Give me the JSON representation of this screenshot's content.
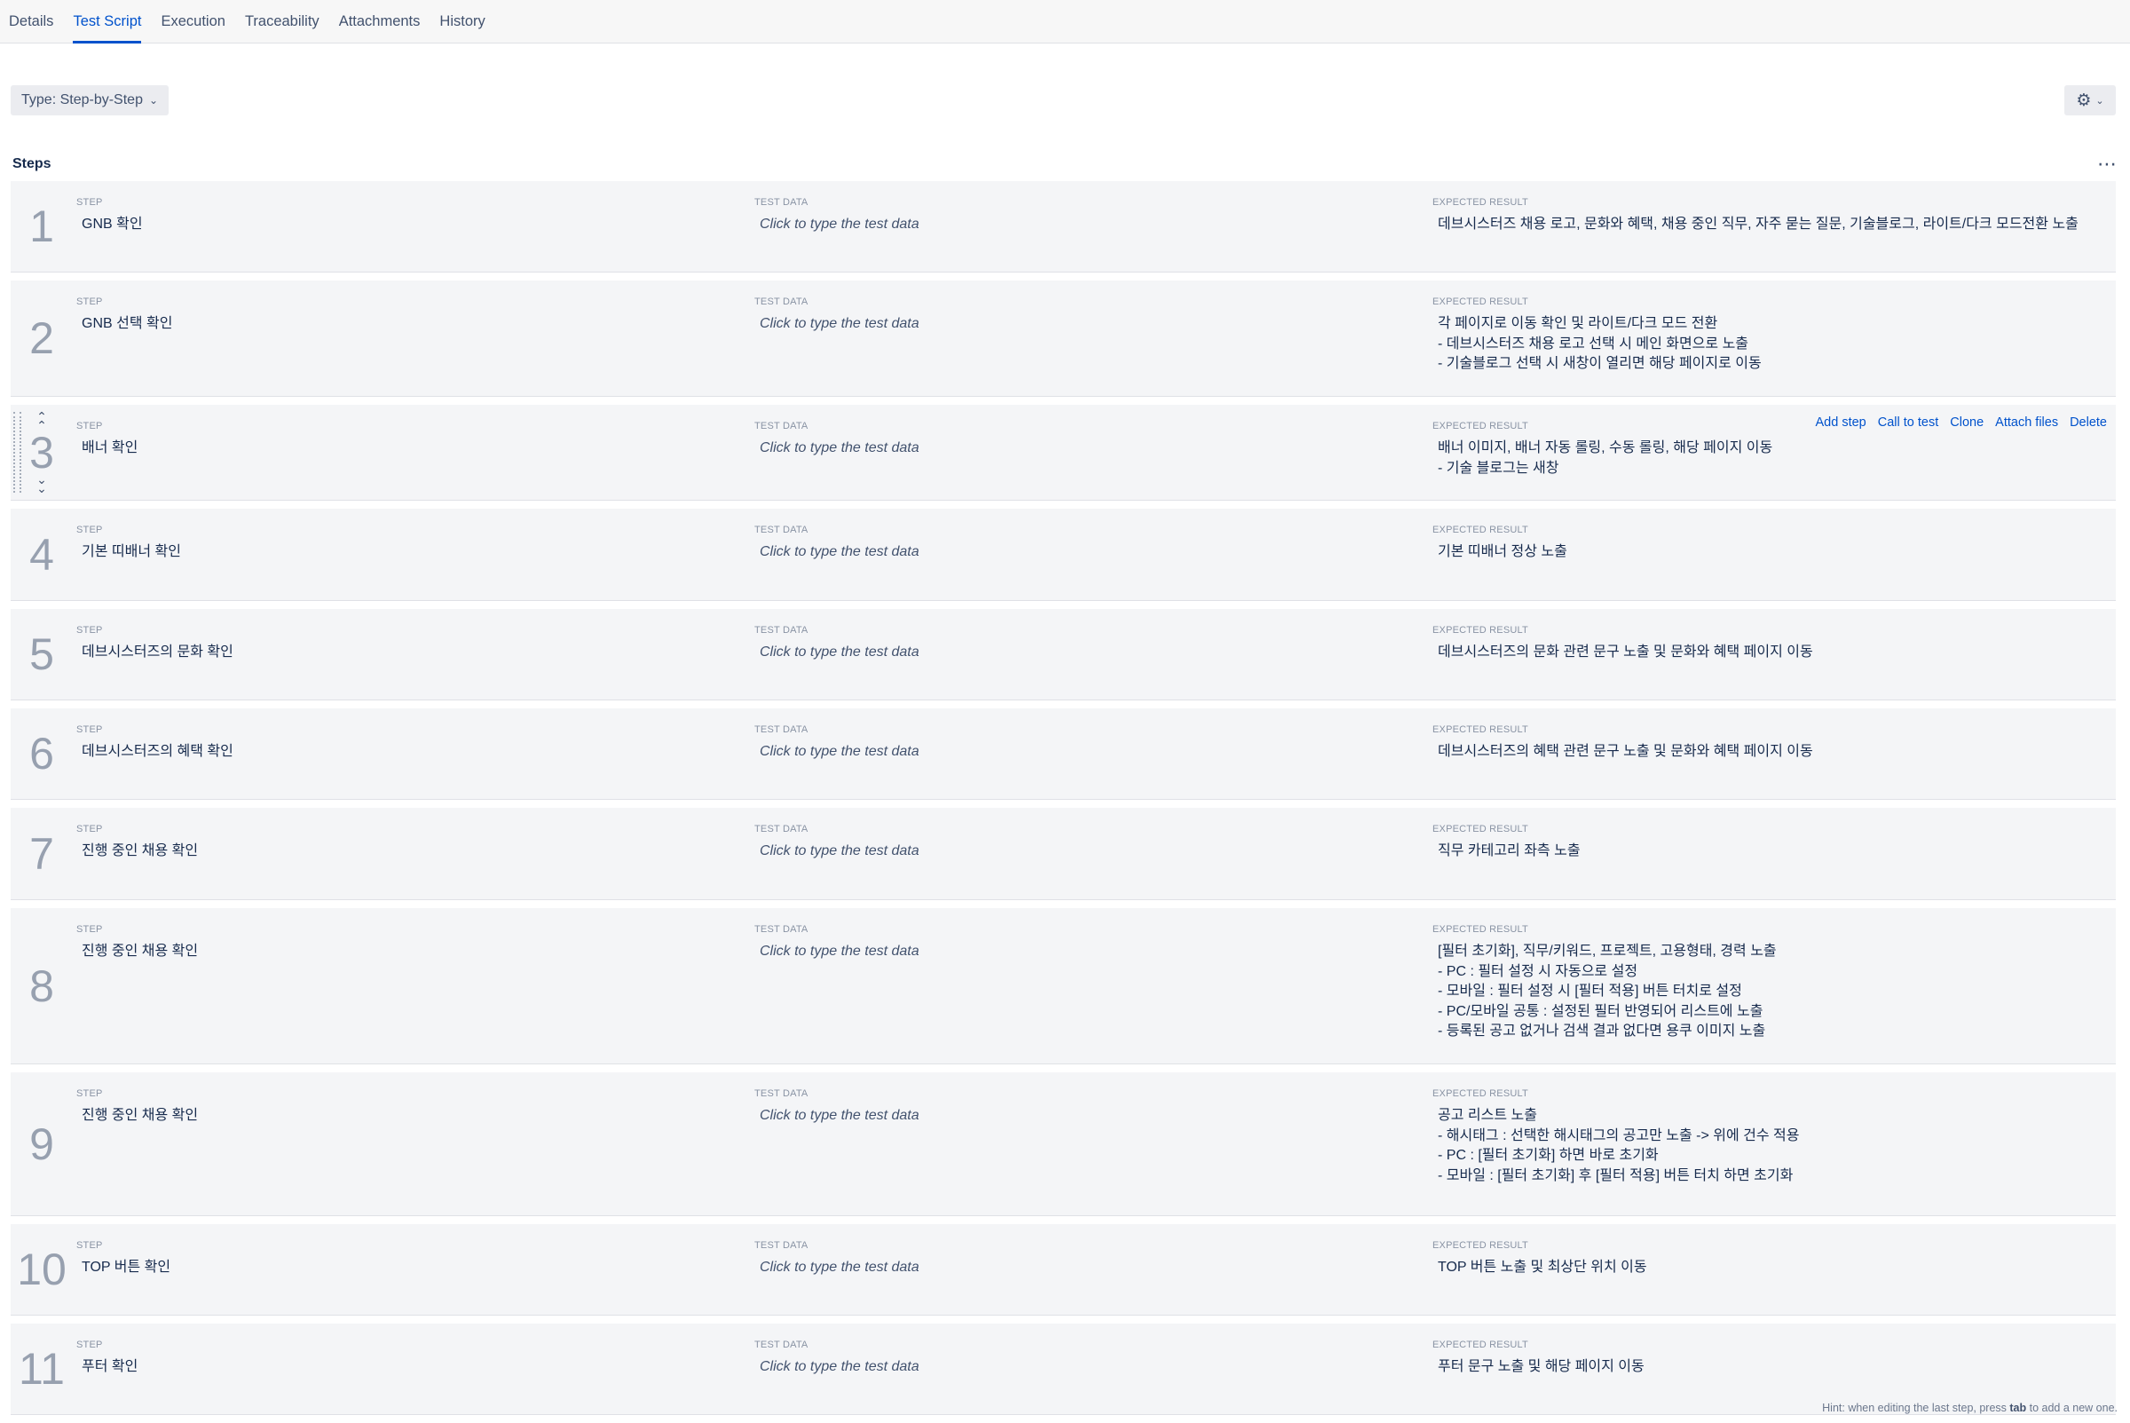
{
  "tabs": [
    {
      "label": "Details"
    },
    {
      "label": "Test Script"
    },
    {
      "label": "Execution"
    },
    {
      "label": "Traceability"
    },
    {
      "label": "Attachments"
    },
    {
      "label": "History"
    }
  ],
  "active_tab": "Test Script",
  "toolbar": {
    "type_label": "Type: Step-by-Step",
    "gear_icon": "gear-icon",
    "chevron_icon": "chevron-down-icon"
  },
  "steps_section": {
    "title": "Steps",
    "more_icon": "more-icon"
  },
  "column_labels": {
    "step": "STEP",
    "test_data": "TEST DATA",
    "expected": "EXPECTED RESULT"
  },
  "row_actions": {
    "add_step": "Add step",
    "call_to_test": "Call to test",
    "clone": "Clone",
    "attach_files": "Attach files",
    "delete": "Delete"
  },
  "steps": [
    {
      "num": "1",
      "step": "GNB 확인",
      "test_data": "Click to type the test data",
      "expected": "데브시스터즈 채용 로고, 문화와 혜택, 채용 중인 직무, 자주 묻는 질문, 기술블로그, 라이트/다크 모드전환 노출"
    },
    {
      "num": "2",
      "step": "GNB 선택 확인",
      "test_data": "Click to type the test data",
      "expected": "각 페이지로 이동 확인 및 라이트/다크 모드 전환\n- 데브시스터즈 채용 로고 선택 시 메인 화면으로 노출\n- 기술블로그 선택 시 새창이 열리면 해당 페이지로 이동"
    },
    {
      "num": "3",
      "step": "배너 확인",
      "test_data": "Click to type the test data",
      "expected": "배너 이미지, 배너 자동 롤링, 수동 롤링, 해당 페이지 이동\n- 기술 블로그는 새창"
    },
    {
      "num": "4",
      "step": "기본 띠배너 확인",
      "test_data": "Click to type the test data",
      "expected": "기본 띠배너 정상 노출"
    },
    {
      "num": "5",
      "step": "데브시스터즈의 문화 확인",
      "test_data": "Click to type the test data",
      "expected": "데브시스터즈의 문화 관련 문구 노출 및 문화와 혜택 페이지 이동"
    },
    {
      "num": "6",
      "step": "데브시스터즈의 혜택 확인",
      "test_data": "Click to type the test data",
      "expected": "데브시스터즈의 혜택 관련 문구 노출 및 문화와 혜택 페이지 이동"
    },
    {
      "num": "7",
      "step": "진행 중인 채용 확인",
      "test_data": "Click to type the test data",
      "expected": "직무 카테고리 좌측 노출"
    },
    {
      "num": "8",
      "step": "진행 중인 채용 확인",
      "test_data": "Click to type the test data",
      "expected": "[필터 초기화], 직무/키워드, 프로젝트, 고용형태, 경력 노출\n- PC : 필터 설정 시 자동으로 설정\n- 모바일 : 필터 설정 시 [필터 적용] 버튼 터치로 설정\n- PC/모바일 공통 : 설정된 필터 반영되어 리스트에 노출\n- 등록된 공고 없거나 검색 결과 없다면 용쿠 이미지 노출"
    },
    {
      "num": "9",
      "step": "진행 중인 채용 확인",
      "test_data": "Click to type the test data",
      "expected": "공고 리스트 노출\n- 해시태그 : 선택한 해시태그의 공고만 노출 -> 위에 건수 적용\n- PC : [필터 초기화] 하면 바로 초기화\n- 모바일 : [필터 초기화] 후 [필터 적용] 버튼 터치 하면 초기화"
    },
    {
      "num": "10",
      "step": "TOP 버튼 확인",
      "test_data": "Click to type the test data",
      "expected": "TOP 버튼 노출 및 최상단 위치 이동"
    },
    {
      "num": "11",
      "step": "푸터 확인",
      "test_data": "Click to type the test data",
      "expected": "푸터 문구 노출 및 해당 페이지 이동"
    }
  ],
  "hint": {
    "before": "Hint: when editing the last step, press ",
    "key": "tab",
    "after": " to add a new one."
  }
}
